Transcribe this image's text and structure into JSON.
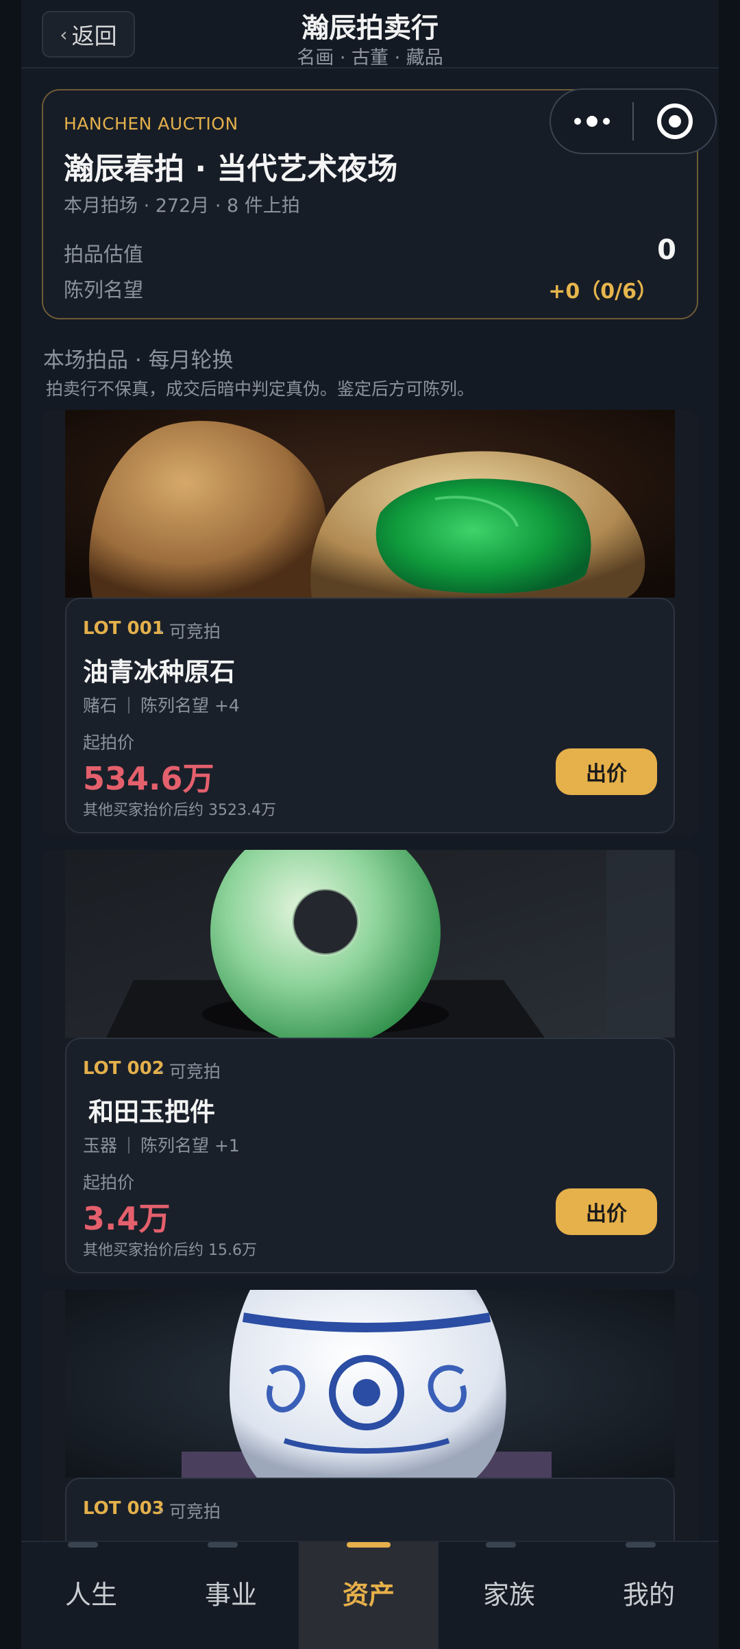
{
  "header": {
    "back_label": "返回",
    "title": "瀚辰拍卖行",
    "subtitle": "名画 · 古董 · 藏品"
  },
  "summary": {
    "tag": "HANCHEN AUCTION",
    "auction_name": "瀚辰春拍 · 当代艺术夜场",
    "meta": "本月拍场 · 272月 · 8 件上拍",
    "estimate_label": "拍品估值",
    "estimate_value": "0",
    "reputation_label": "陈列名望",
    "reputation_value": "+0（0/6）"
  },
  "section": {
    "title": "本场拍品 · 每月轮换",
    "note": "拍卖行不保真，成交后暗中判定真伪。鉴定后方可陈列。"
  },
  "lots": [
    {
      "lot_no": "LOT 001",
      "status": "· 可竞拍",
      "name": "油青冰种原石",
      "category": "赌石",
      "reputation": "陈列名望 +4",
      "start_label": "起拍价",
      "price": "534.6万",
      "other_bid": "其他买家抬价后约 3523.4万",
      "bid_label": "出价",
      "image": "jade-raw-stone"
    },
    {
      "lot_no": "LOT 002",
      "status": "· 可竞拍",
      "name": "和田玉把件",
      "category": "玉器",
      "reputation": "陈列名望 +1",
      "start_label": "起拍价",
      "price": "3.4万",
      "other_bid": "其他买家抬价后约 15.6万",
      "bid_label": "出价",
      "image": "jade-disc"
    },
    {
      "lot_no": "LOT 003",
      "status": "· 可竞拍",
      "image": "blue-white-porcelain-vase"
    }
  ],
  "tabs": [
    {
      "label": "人生",
      "active": false
    },
    {
      "label": "事业",
      "active": false
    },
    {
      "label": "资产",
      "active": true
    },
    {
      "label": "家族",
      "active": false
    },
    {
      "label": "我的",
      "active": false
    }
  ],
  "colors": {
    "accent": "#e6b04a",
    "price": "#e4606c",
    "background": "#141a23"
  }
}
